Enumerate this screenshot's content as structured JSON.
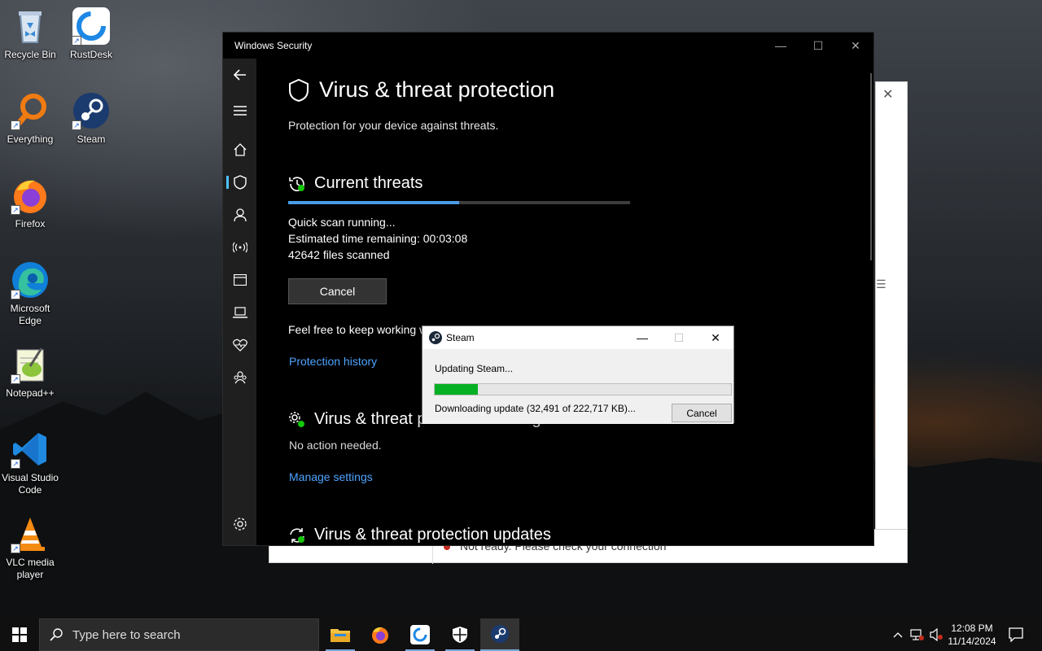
{
  "desktop": {
    "icons": [
      {
        "label": "Recycle Bin"
      },
      {
        "label": "RustDesk"
      },
      {
        "label": "Everything"
      },
      {
        "label": "Steam"
      },
      {
        "label": "Firefox"
      },
      {
        "label": "Microsoft Edge"
      },
      {
        "label": "Notepad++"
      },
      {
        "label": "Visual Studio Code"
      },
      {
        "label": "VLC media player"
      }
    ]
  },
  "background_window": {
    "status_text": "Not ready. Please check your connection"
  },
  "windows_security": {
    "window_title": "Windows Security",
    "page_title": "Virus & threat protection",
    "page_subtitle": "Protection for your device against threats.",
    "current_threats": {
      "heading": "Current threats",
      "scan_progress_percent": 50,
      "scan_status": "Quick scan running...",
      "time_remaining_label": "Estimated time remaining:",
      "time_remaining_value": "00:03:08",
      "files_scanned": "42642 files scanned",
      "cancel_label": "Cancel",
      "keep_working_text": "Feel free to keep working while we scan your device.",
      "history_link": "Protection history"
    },
    "settings": {
      "heading": "Virus & threat protection settings",
      "status": "No action needed.",
      "manage_link": "Manage settings"
    },
    "updates": {
      "heading": "Virus & threat protection updates"
    },
    "nav_icons": [
      "back-icon",
      "menu-icon",
      "home-icon",
      "shield-icon",
      "account-icon",
      "network-icon",
      "app-browser-icon",
      "device-security-icon",
      "health-icon",
      "family-icon",
      "settings-icon"
    ]
  },
  "steam_dialog": {
    "title": "Steam",
    "updating_text": "Updating Steam...",
    "progress_fraction": 0.1459,
    "download_text": "Downloading update (32,491 of 222,717 KB)...",
    "cancel_label": "Cancel"
  },
  "taskbar": {
    "search_placeholder": "Type here to search",
    "pinned": [
      "file-explorer-icon",
      "firefox-icon",
      "rustdesk-icon",
      "windows-security-icon",
      "steam-icon"
    ],
    "time": "12:08 PM",
    "date": "11/14/2024"
  }
}
